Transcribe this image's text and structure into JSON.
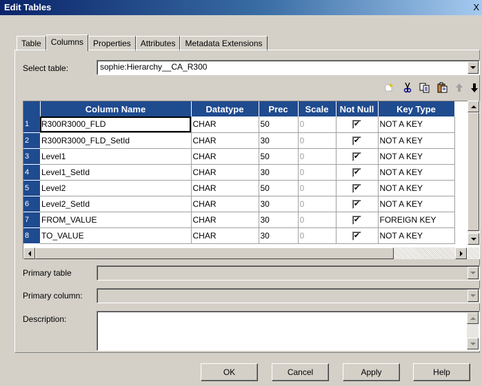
{
  "window": {
    "title": "Edit Tables",
    "close_glyph": "X"
  },
  "tabs": [
    {
      "label": "Table"
    },
    {
      "label": "Columns",
      "active": true
    },
    {
      "label": "Properties"
    },
    {
      "label": "Attributes"
    },
    {
      "label": "Metadata Extensions"
    }
  ],
  "select_table": {
    "label": "Select table:",
    "value": "sophie:Hierarchy__CA_R300"
  },
  "toolbar_icons": [
    "new-column-icon",
    "cut-icon",
    "copy-icon",
    "paste-icon",
    "move-up-icon",
    "move-down-icon"
  ],
  "columns_grid": {
    "headers": {
      "name": "Column Name",
      "datatype": "Datatype",
      "prec": "Prec",
      "scale": "Scale",
      "not_null": "Not Null",
      "key_type": "Key Type"
    },
    "rows": [
      {
        "num": "1",
        "name": "R300R3000_FLD",
        "datatype": "CHAR",
        "prec": "50",
        "scale": "0",
        "not_null": true,
        "key_type": "NOT A KEY"
      },
      {
        "num": "2",
        "name": "R300R3000_FLD_SetId",
        "datatype": "CHAR",
        "prec": "30",
        "scale": "0",
        "not_null": true,
        "key_type": "NOT A KEY"
      },
      {
        "num": "3",
        "name": "Level1",
        "datatype": "CHAR",
        "prec": "50",
        "scale": "0",
        "not_null": true,
        "key_type": "NOT A KEY"
      },
      {
        "num": "4",
        "name": "Level1_SetId",
        "datatype": "CHAR",
        "prec": "30",
        "scale": "0",
        "not_null": true,
        "key_type": "NOT A KEY"
      },
      {
        "num": "5",
        "name": "Level2",
        "datatype": "CHAR",
        "prec": "50",
        "scale": "0",
        "not_null": true,
        "key_type": "NOT A KEY"
      },
      {
        "num": "6",
        "name": "Level2_SetId",
        "datatype": "CHAR",
        "prec": "30",
        "scale": "0",
        "not_null": true,
        "key_type": "NOT A KEY"
      },
      {
        "num": "7",
        "name": "FROM_VALUE",
        "datatype": "CHAR",
        "prec": "30",
        "scale": "0",
        "not_null": true,
        "key_type": "FOREIGN KEY"
      },
      {
        "num": "8",
        "name": "TO_VALUE",
        "datatype": "CHAR",
        "prec": "30",
        "scale": "0",
        "not_null": true,
        "key_type": "NOT A KEY"
      }
    ]
  },
  "fields": {
    "primary_table": {
      "label": "Primary table",
      "value": ""
    },
    "primary_column": {
      "label": "Primary column:",
      "value": ""
    },
    "description": {
      "label": "Description:",
      "value": ""
    }
  },
  "buttons": {
    "ok": "OK",
    "cancel": "Cancel",
    "apply": "Apply",
    "help": "Help"
  },
  "colors": {
    "grid_header": "#1f4b8f",
    "titlebar_start": "#0a246a",
    "face": "#d4d0c8"
  }
}
